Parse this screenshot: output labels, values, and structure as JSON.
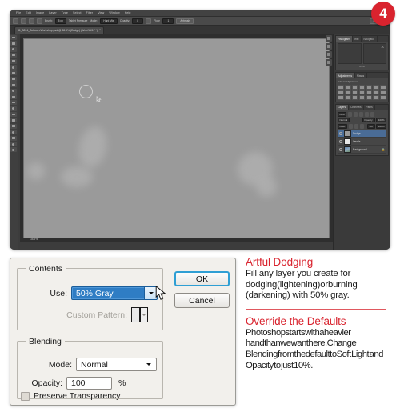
{
  "badge": {
    "number": "4"
  },
  "photoshop": {
    "menubar": [
      "File",
      "Edit",
      "Image",
      "Layer",
      "Type",
      "Select",
      "Filter",
      "View",
      "Window",
      "Help"
    ],
    "options_bar": {
      "tool_icons": [
        "brush-tool-icon",
        "airbrush-icon",
        "flow-icon",
        "tablet-pressure-icon"
      ],
      "brush_label": "Brush:",
      "brush_value": "5 px",
      "mode_label": "Mode:",
      "mode_value": "Hard Mix",
      "opacity_label": "Opacity:",
      "opacity_value": "8",
      "flow_label": "Flow:",
      "flow_value": "1",
      "airbrush_button": "Airbrush",
      "tablet_note": "Tablet Pressure",
      "right_button": "Essentials"
    },
    "document_tab": {
      "name": "41_0814_SoftwareWorkshop.psd @ 38.5% (Dodge) (Web/16/17 *)",
      "close": "×"
    },
    "canvas": {
      "status": "38.5%",
      "brush_cursor": "brush-cursor-icon"
    },
    "panels": {
      "histogram": {
        "tabs": [
          "Histogram",
          "Info",
          "Navigator"
        ],
        "active_tab": "Histogram",
        "caption": "RGB",
        "warning_icon": "cached-data-warning-icon"
      },
      "adjustments": {
        "tabs": [
          "Adjustments",
          "Masks"
        ],
        "active_tab": "Adjustments",
        "subtitle": "Add an adjustment"
      },
      "layers": {
        "tabs": [
          "Layers",
          "Channels",
          "Paths"
        ],
        "active_tab": "Layers",
        "filter_value": "Kind",
        "blend_mode": "Normal",
        "opacity_label": "Opacity:",
        "opacity_value": "100%",
        "lock_label": "Lock:",
        "fill_label": "Fill:",
        "fill_value": "100%",
        "rows": [
          {
            "name": "Dodge",
            "thumb": "gray",
            "selected": true,
            "locked": false
          },
          {
            "name": "Levels",
            "thumb": "white",
            "selected": false,
            "locked": false
          },
          {
            "name": "Background",
            "thumb": "photo",
            "selected": false,
            "locked": true,
            "lock_glyph": "🔒"
          }
        ]
      }
    }
  },
  "fill_dialog": {
    "contents": {
      "legend": "Contents",
      "use_label": "Use:",
      "use_value": "50% Gray",
      "custom_pattern_label": "Custom Pattern:",
      "pattern_swatch": "pattern-swatch-icon",
      "dropdown_icon": "chevron-down-icon"
    },
    "blending": {
      "legend": "Blending",
      "mode_label": "Mode:",
      "mode_value": "Normal",
      "opacity_label": "Opacity:",
      "opacity_value": "100",
      "percent_symbol": "%",
      "preserve_label": "Preserve Transparency",
      "preserve_checked": false
    },
    "buttons": {
      "ok": "OK",
      "cancel": "Cancel"
    },
    "cursor": "mouse-pointer-icon"
  },
  "tips": [
    {
      "title": "Artful Dodging",
      "body": "Fill any layer you create for dodging(lightening)orburning (darkening) with 50% gray."
    },
    {
      "title": "Override the Defaults",
      "body": "Photoshopstartswithaheavier handthanwewanthere.Change BlendingfromthedefaulttoSoft Light and Opacity to just 10%."
    }
  ],
  "colors": {
    "accent_red": "#d9232e",
    "selection_blue": "#2f7dc4",
    "focus_blue": "#2f9fd4",
    "dialog_bg": "#f2f0ec",
    "canvas_gray": "#9a9a9a"
  }
}
